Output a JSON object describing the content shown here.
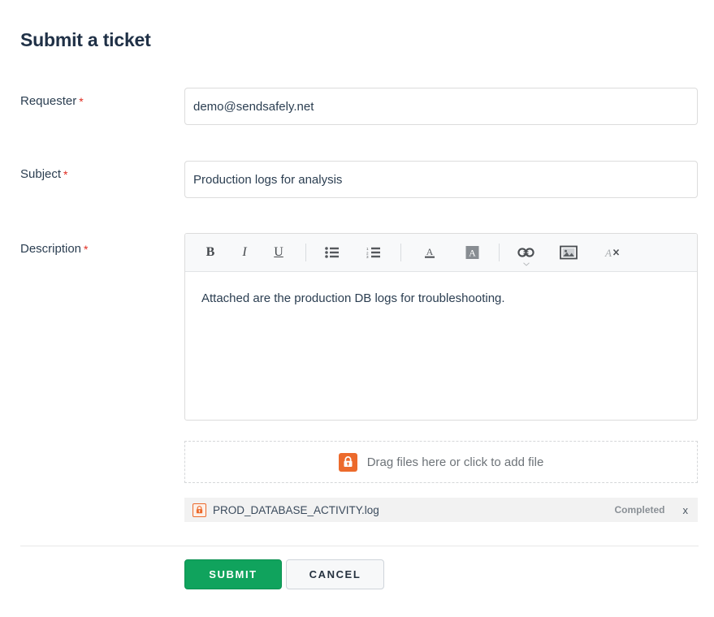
{
  "page": {
    "title": "Submit a ticket"
  },
  "form": {
    "requester": {
      "label": "Requester",
      "required_mark": "*",
      "value": "demo@sendsafely.net",
      "placeholder": ""
    },
    "subject": {
      "label": "Subject",
      "required_mark": "*",
      "value": "Production logs for analysis",
      "placeholder": ""
    },
    "description": {
      "label": "Description",
      "required_mark": "*",
      "body_text": "Attached are the production DB logs for troubleshooting.",
      "toolbar": [
        {
          "name": "bold",
          "glyph": "B",
          "tooltip": "Bold"
        },
        {
          "name": "italic",
          "glyph": "I",
          "tooltip": "Italic"
        },
        {
          "name": "underline",
          "glyph": "U",
          "tooltip": "Underline"
        },
        {
          "name": "bulleted-list",
          "glyph": "",
          "tooltip": "Bulleted list"
        },
        {
          "name": "numbered-list",
          "glyph": "",
          "tooltip": "Numbered list"
        },
        {
          "name": "text-color",
          "glyph": "A",
          "tooltip": "Text color"
        },
        {
          "name": "background-color",
          "glyph": "A",
          "tooltip": "Background color"
        },
        {
          "name": "link",
          "glyph": "",
          "tooltip": "Insert link"
        },
        {
          "name": "image",
          "glyph": "",
          "tooltip": "Insert image"
        },
        {
          "name": "remove-formatting",
          "glyph": "",
          "tooltip": "Remove formatting"
        }
      ]
    }
  },
  "attachments": {
    "dropzone_text": "Drag files here or click to add file",
    "files": [
      {
        "name": "PROD_DATABASE_ACTIVITY.log",
        "status": "Completed",
        "remove_label": "x"
      }
    ]
  },
  "actions": {
    "submit_label": "SUBMIT",
    "cancel_label": "CANCEL"
  },
  "colors": {
    "title": "#1f3046",
    "label": "#2b3e51",
    "required_star": "#e02b20",
    "submit_green": "#10a35d",
    "lock_orange": "#ec6a2c",
    "border_gray": "#dcdcdc",
    "toolbar_bg": "#f8f9fa",
    "file_row_bg": "#f2f2f2"
  }
}
